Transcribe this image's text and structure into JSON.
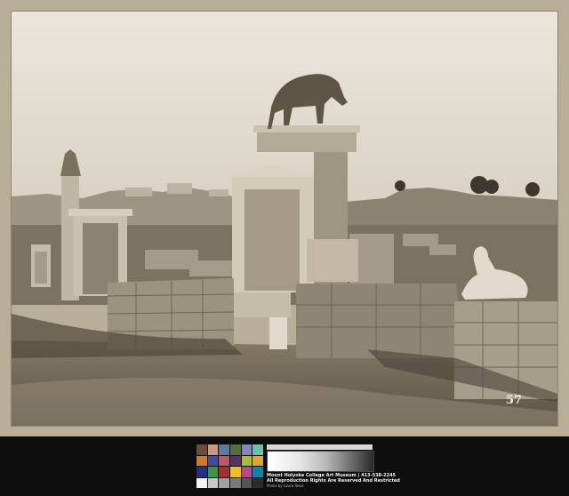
{
  "photo": {
    "description_label": "Kerameikos cemetery stelae with bull and dog sculptures, Acropolis in background",
    "plate_number": "57"
  },
  "footer": {
    "credit_line_1": "Mount Holyoke College Art Museum | 413-538-2245",
    "credit_line_2": "All Reproduction Rights Are Reserved And Restricted",
    "credit_line_3": "Photo by Laura Shea"
  },
  "colors": {
    "mount": "#b9ae97",
    "sky": "#e3ddd1",
    "ground": "#6d6354",
    "footer": "#0e0e0e"
  },
  "color_checker": [
    "#6e4a3a",
    "#c99b86",
    "#5e7aa3",
    "#5a6b3c",
    "#8a85b8",
    "#6fc0aa",
    "#d27a2a",
    "#3f4fa0",
    "#c35562",
    "#553268",
    "#a0bd3c",
    "#e4a22e",
    "#262f86",
    "#3f944a",
    "#a72d33",
    "#eec11f",
    "#b7478f",
    "#0f84a4",
    "#f4f4f4",
    "#c8c8c8",
    "#a0a0a0",
    "#7a7a7a",
    "#555555",
    "#2c2c2c"
  ]
}
